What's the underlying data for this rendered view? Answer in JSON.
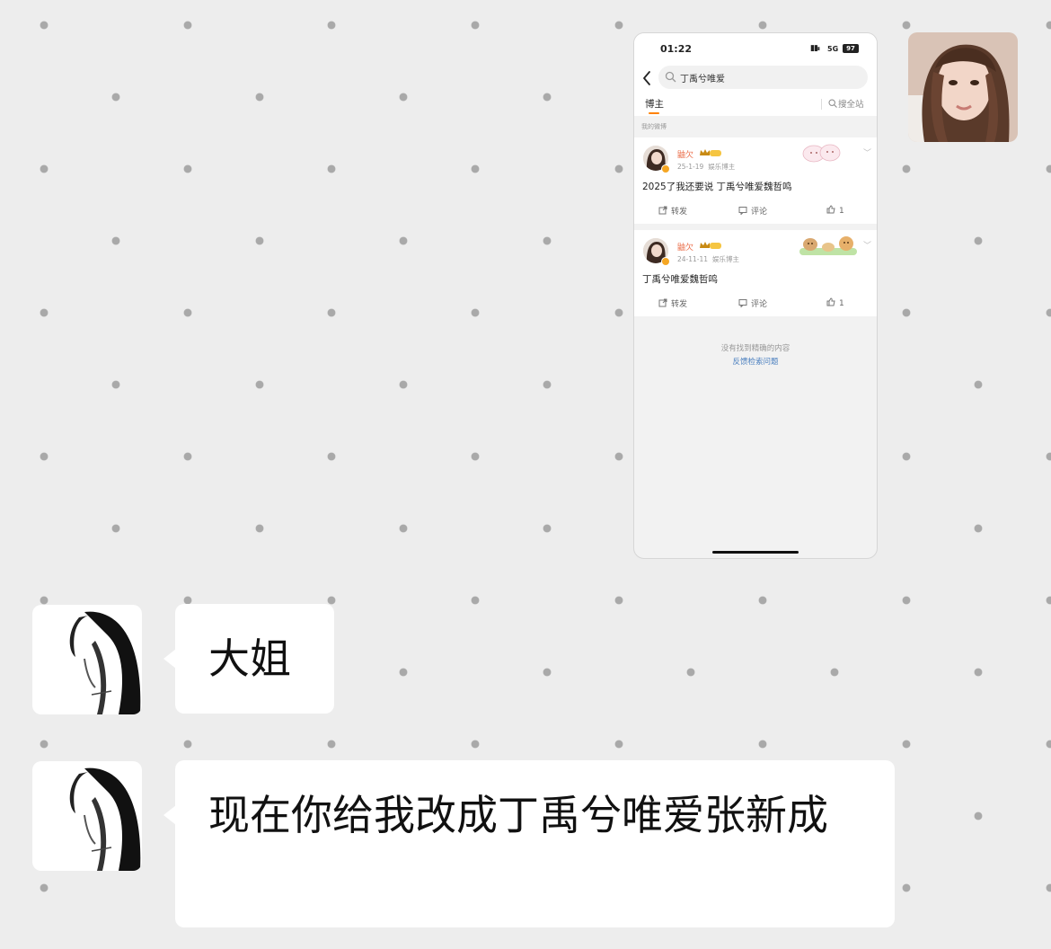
{
  "screenshot": {
    "status_bar": {
      "time": "01:22",
      "network": "5G",
      "battery": "97"
    },
    "search_query": "丁禹兮唯爱",
    "tab_label": "博主",
    "search_all_label": "搜全站",
    "section_label": "我的微博",
    "posts": [
      {
        "username": "鼬欠",
        "date": "25-1-19",
        "tag": "娱乐博主",
        "text": "2025了我还要说 丁禹兮唯爱魏哲鸣",
        "repost": "转发",
        "comment": "评论",
        "likes": "1"
      },
      {
        "username": "鼬欠",
        "date": "24-11-11",
        "tag": "娱乐博主",
        "text": "丁禹兮唯爱魏哲鸣",
        "repost": "转发",
        "comment": "评论",
        "likes": "1"
      }
    ],
    "no_result_text": "没有找到精确的内容",
    "feedback_link": "反馈检索问题"
  },
  "messages": [
    {
      "text": "大姐"
    },
    {
      "text": "现在你给我改成丁禹兮唯爱张新成"
    }
  ],
  "colors": {
    "background": "#ededed",
    "dot": "#a9a9a9",
    "bubble": "#ffffff",
    "accent": "#ff8200",
    "username": "#eb7350",
    "link": "#4a7fbf"
  },
  "icons": [
    "back-arrow-icon",
    "search-icon",
    "repost-icon",
    "comment-icon",
    "like-icon",
    "verified-icon",
    "crown-icon"
  ]
}
